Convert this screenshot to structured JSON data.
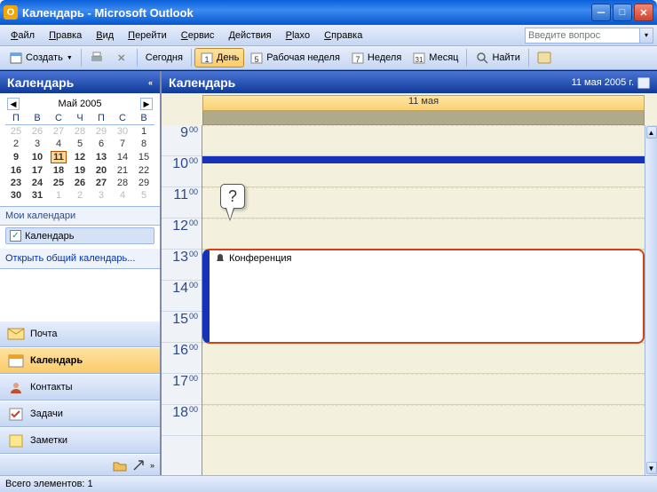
{
  "title": "Календарь - Microsoft Outlook",
  "menu": [
    "Файл",
    "Правка",
    "Вид",
    "Перейти",
    "Сервис",
    "Действия",
    "Plaxo",
    "Справка"
  ],
  "help_placeholder": "Введите вопрос",
  "toolbar": {
    "new": "Создать",
    "today": "Сегодня",
    "day": "День",
    "workweek": "Рабочая неделя",
    "week": "Неделя",
    "month": "Месяц",
    "find": "Найти"
  },
  "nav": {
    "title": "Календарь",
    "minical": {
      "title": "Май 2005",
      "dow": [
        "П",
        "В",
        "С",
        "Ч",
        "П",
        "С",
        "В"
      ],
      "rows": [
        [
          {
            "d": 25,
            "dim": true
          },
          {
            "d": 26,
            "dim": true
          },
          {
            "d": 27,
            "dim": true
          },
          {
            "d": 28,
            "dim": true
          },
          {
            "d": 29,
            "dim": true
          },
          {
            "d": 30,
            "dim": true
          },
          {
            "d": 1
          }
        ],
        [
          {
            "d": 2
          },
          {
            "d": 3
          },
          {
            "d": 4
          },
          {
            "d": 5
          },
          {
            "d": 6
          },
          {
            "d": 7
          },
          {
            "d": 8
          }
        ],
        [
          {
            "d": 9,
            "b": true
          },
          {
            "d": 10,
            "b": true
          },
          {
            "d": 11,
            "today": true
          },
          {
            "d": 12,
            "b": true
          },
          {
            "d": 13,
            "b": true
          },
          {
            "d": 14
          },
          {
            "d": 15
          }
        ],
        [
          {
            "d": 16,
            "b": true
          },
          {
            "d": 17,
            "b": true
          },
          {
            "d": 18,
            "b": true
          },
          {
            "d": 19,
            "b": true
          },
          {
            "d": 20,
            "b": true
          },
          {
            "d": 21
          },
          {
            "d": 22
          }
        ],
        [
          {
            "d": 23,
            "b": true
          },
          {
            "d": 24,
            "b": true
          },
          {
            "d": 25,
            "b": true
          },
          {
            "d": 26,
            "b": true
          },
          {
            "d": 27,
            "b": true
          },
          {
            "d": 28
          },
          {
            "d": 29
          }
        ],
        [
          {
            "d": 30,
            "b": true
          },
          {
            "d": 31,
            "b": true
          },
          {
            "d": 1,
            "dim": true
          },
          {
            "d": 2,
            "dim": true
          },
          {
            "d": 3,
            "dim": true
          },
          {
            "d": 4,
            "dim": true
          },
          {
            "d": 5,
            "dim": true
          }
        ]
      ]
    },
    "mycals": "Мои календари",
    "calname": "Календарь",
    "openshared": "Открыть общий календарь...",
    "buttons": [
      {
        "label": "Почта",
        "icon": "mail",
        "color": "#f0a020"
      },
      {
        "label": "Календарь",
        "icon": "calendar",
        "active": true,
        "color": "#f0a020"
      },
      {
        "label": "Контакты",
        "icon": "contacts",
        "color": "#c05030"
      },
      {
        "label": "Задачи",
        "icon": "tasks",
        "color": "#4aa030"
      },
      {
        "label": "Заметки",
        "icon": "notes",
        "color": "#f0c040"
      }
    ]
  },
  "main": {
    "title": "Календарь",
    "date": "11 мая 2005 г.",
    "dayhead": "11 мая",
    "hours": [
      "9",
      "10",
      "11",
      "12",
      "13",
      "14",
      "15",
      "16",
      "17",
      "18"
    ],
    "min": "00",
    "appt": "Конференция",
    "callout": "?"
  },
  "status": "Всего элементов: 1"
}
